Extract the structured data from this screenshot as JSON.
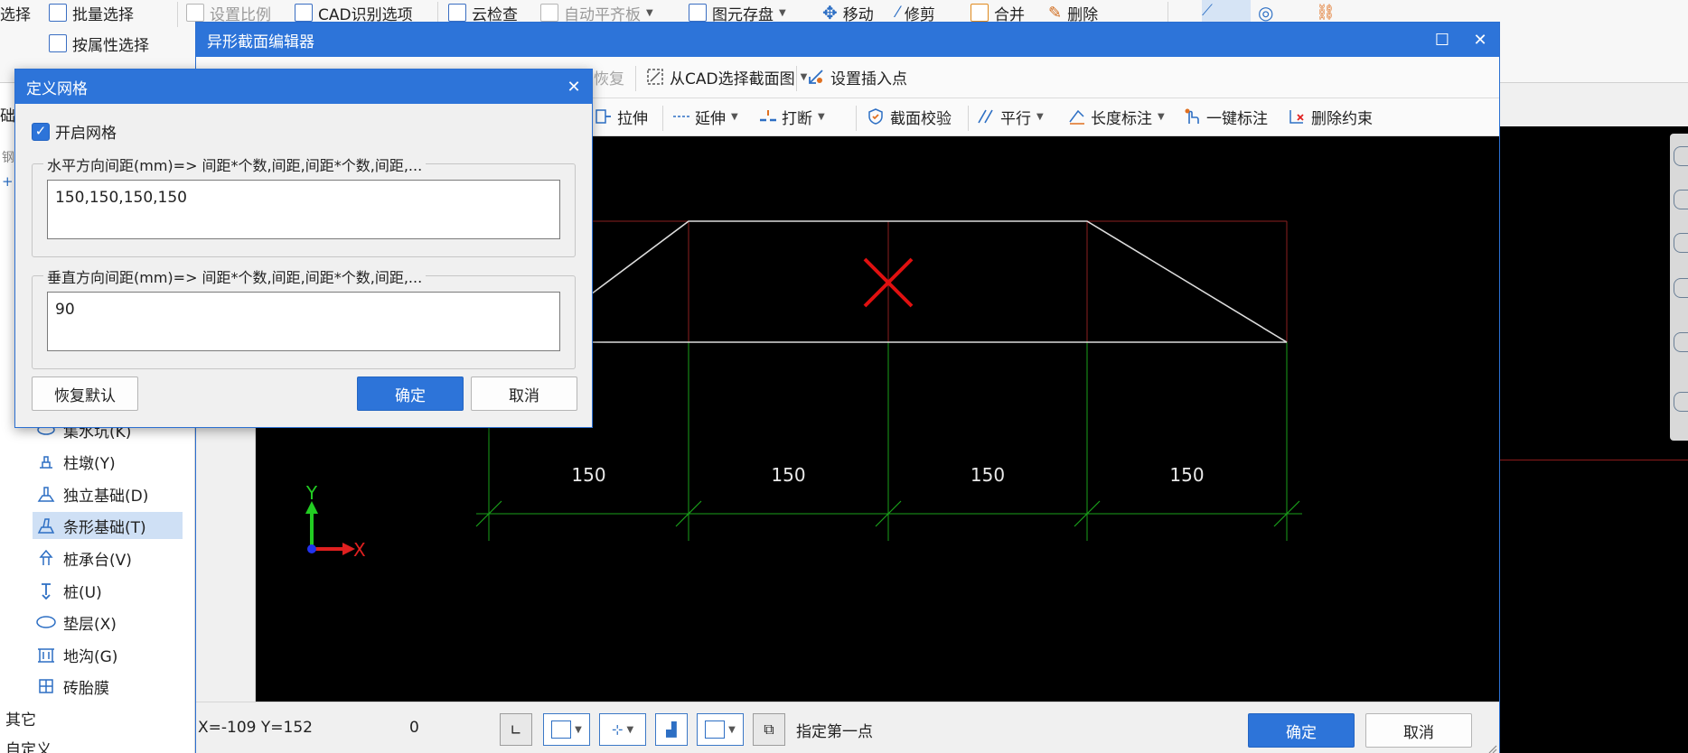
{
  "app_toolbar": {
    "row1": [
      "选择",
      "批量选择",
      "设置比例",
      "CAD识别选项",
      "云检查",
      "自动平齐板",
      "图元存盘",
      "移动",
      "修剪",
      "合并",
      "删除"
    ],
    "row2": [
      "按属性选择"
    ]
  },
  "left_panel": {
    "top_fragments": [
      "础",
      "钢筋"
    ],
    "items": [
      {
        "label": "集水坑(K)",
        "icon": "sump-pit-icon"
      },
      {
        "label": "柱墩(Y)",
        "icon": "column-pier-icon"
      },
      {
        "label": "独立基础(D)",
        "icon": "isolated-footing-icon"
      },
      {
        "label": "条形基础(T)",
        "icon": "strip-footing-icon",
        "selected": true
      },
      {
        "label": "桩承台(V)",
        "icon": "pile-cap-icon"
      },
      {
        "label": "桩(U)",
        "icon": "pile-icon"
      },
      {
        "label": "垫层(X)",
        "icon": "cushion-layer-icon"
      },
      {
        "label": "地沟(G)",
        "icon": "trench-icon"
      },
      {
        "label": "砖胎膜",
        "icon": "brick-mold-icon"
      }
    ],
    "bottom_groups": [
      "其它",
      "自定义"
    ]
  },
  "editor": {
    "title": "异形截面编辑器",
    "toolbar1": {
      "restore": "恢复",
      "select_from_cad": "从CAD选择截面图",
      "set_insert_point": "设置插入点"
    },
    "toolbar2": {
      "stretch": "拉伸",
      "extend": "延伸",
      "break": "打断",
      "section_check": "截面校验",
      "parallel": "平行",
      "length_dim": "长度标注",
      "auto_dim": "一键标注",
      "delete_constraint": "删除约束"
    },
    "canvas": {
      "dimensions": [
        "150",
        "150",
        "150",
        "150"
      ],
      "axis_x": "X",
      "axis_y": "Y"
    },
    "status": {
      "coords": "X=-109 Y=152",
      "value": "0",
      "prompt": "指定第一点",
      "ok": "确定",
      "cancel": "取消"
    }
  },
  "grid_dialog": {
    "title": "定义网格",
    "enable_label": "开启网格",
    "enable_checked": true,
    "horizontal_legend": "水平方向间距(mm)=> 间距*个数,间距,间距*个数,间距,...",
    "horizontal_value": "150,150,150,150",
    "vertical_legend": "垂直方向间距(mm)=> 间距*个数,间距,间距*个数,间距,...",
    "vertical_value": "90",
    "restore_default": "恢复默认",
    "ok": "确定",
    "cancel": "取消"
  },
  "colors": {
    "accent": "#2d74d9",
    "grid_green": "#1aa01a",
    "grid_red": "#8b2020",
    "shape_white": "#dcdcdc",
    "marker_red": "#e01010"
  }
}
